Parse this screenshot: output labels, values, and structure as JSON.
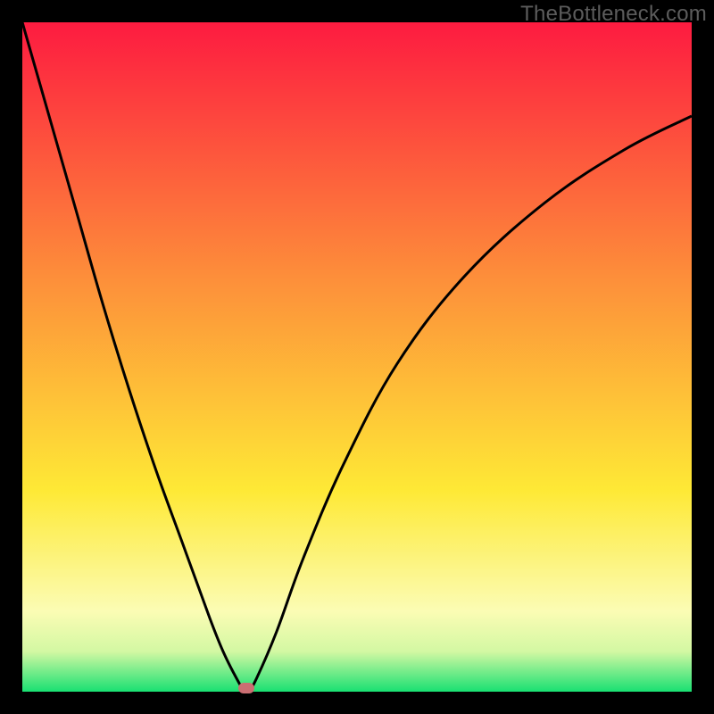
{
  "watermark": "TheBottleneck.com",
  "colors": {
    "top": "#fd1b40",
    "mid_upper": "#fd8e3a",
    "mid": "#fee936",
    "mid_lower": "#fbfcb4",
    "near_bottom": "#d3f8a3",
    "bottom": "#19e072",
    "curve": "#000000",
    "marker": "#cb6e72",
    "frame": "#000000"
  },
  "chart_data": {
    "type": "line",
    "title": "",
    "xlabel": "",
    "ylabel": "",
    "xlim": [
      0,
      100
    ],
    "ylim": [
      0,
      100
    ],
    "note": "V-shaped bottleneck curve with minimum near one-third of x-axis; watermark from TheBottleneck.com; gradient background red→green indicates bottleneck severity (top=bad, bottom=good).",
    "series": [
      {
        "name": "bottleneck-curve",
        "x": [
          0,
          4,
          8,
          12,
          16,
          20,
          24,
          28,
          30,
          32,
          33,
          34,
          35,
          38,
          42,
          48,
          56,
          66,
          78,
          90,
          100
        ],
        "y": [
          100,
          86,
          72,
          58,
          45,
          33,
          22,
          11,
          6,
          2,
          0.5,
          0.5,
          2,
          9,
          20,
          34,
          49,
          62,
          73,
          81,
          86
        ]
      }
    ],
    "minimum_point": {
      "x": 33.5,
      "y": 0.5
    },
    "gradient_stops": [
      {
        "pct": 0,
        "color": "#fd1b40"
      },
      {
        "pct": 38,
        "color": "#fd8e3a"
      },
      {
        "pct": 70,
        "color": "#fee936"
      },
      {
        "pct": 88,
        "color": "#fbfcb4"
      },
      {
        "pct": 94,
        "color": "#d3f8a3"
      },
      {
        "pct": 100,
        "color": "#19e072"
      }
    ]
  }
}
